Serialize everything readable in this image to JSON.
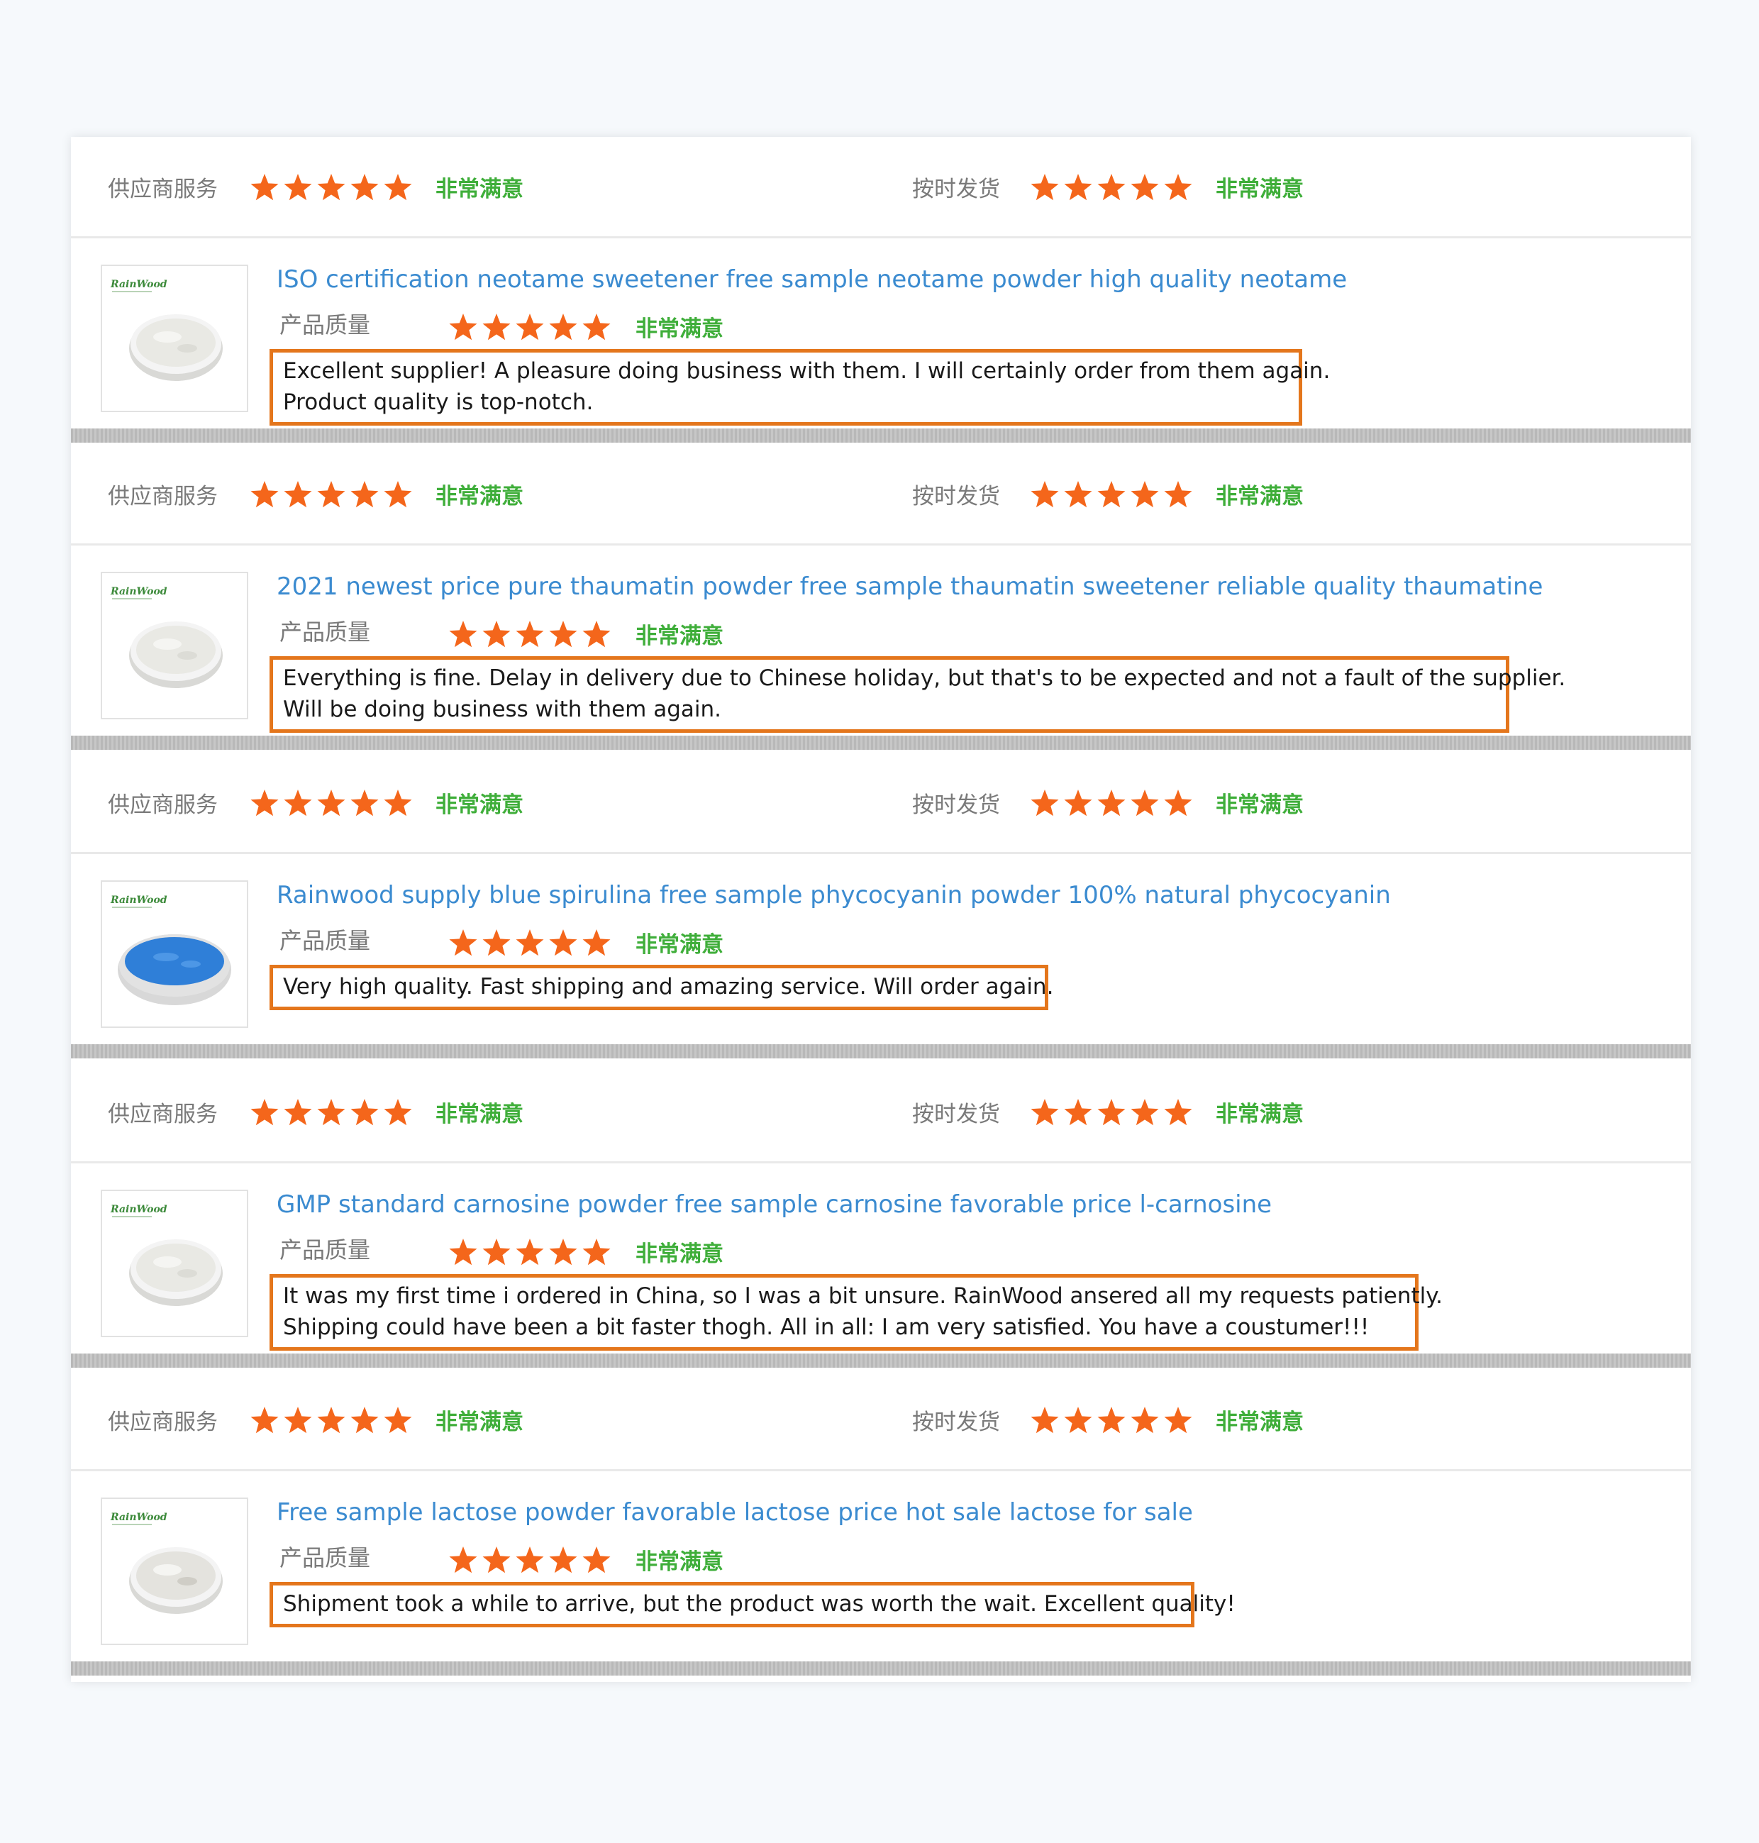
{
  "labels": {
    "supplier_service": "供应商服务",
    "on_time_delivery": "按时发货",
    "product_quality": "产品质量",
    "rating_text": "非常满意"
  },
  "colors": {
    "star": "#f4661b",
    "rating_text": "#3fae3a",
    "title_link": "#3b8bd0",
    "highlight_border": "#e4761c"
  },
  "reviews": [
    {
      "title": "ISO certification neotame sweetener free sample neotame powder high quality neotame",
      "supplier_service_stars": 5,
      "on_time_delivery_stars": 5,
      "product_quality_stars": 5,
      "thumbnail": {
        "brand": "RainWood",
        "powder": "white"
      },
      "comment_lines": [
        "Excellent supplier! A pleasure doing business with them. I will certainly order from them again.",
        "Product quality is top-notch."
      ]
    },
    {
      "title": "2021 newest price pure thaumatin powder free sample thaumatin sweetener reliable quality thaumatine",
      "supplier_service_stars": 5,
      "on_time_delivery_stars": 5,
      "product_quality_stars": 5,
      "thumbnail": {
        "brand": "RainWood",
        "powder": "white"
      },
      "comment_lines": [
        "Everything  is fine. Delay in delivery due to Chinese holiday, but that's to be expected and not a fault of the supplier.",
        "Will be doing business with them again."
      ]
    },
    {
      "title": "Rainwood supply blue spirulina free sample phycocyanin powder 100% natural phycocyanin",
      "supplier_service_stars": 5,
      "on_time_delivery_stars": 5,
      "product_quality_stars": 5,
      "thumbnail": {
        "brand": "RainWood",
        "powder": "blue"
      },
      "comment_lines": [
        "Very high quality. Fast shipping and amazing service. Will order again."
      ]
    },
    {
      "title": "GMP standard carnosine powder free sample carnosine favorable price l-carnosine",
      "supplier_service_stars": 5,
      "on_time_delivery_stars": 5,
      "product_quality_stars": 5,
      "thumbnail": {
        "brand": "RainWood",
        "powder": "white"
      },
      "comment_lines": [
        "It was my first time i ordered in China, so I was a bit unsure.  RainWood ansered all my requests patiently.",
        "Shipping could have been a bit faster thogh. All in all: I am very satisfied. You have a coustumer!!!"
      ]
    },
    {
      "title": "Free sample lactose powder favorable lactose price hot sale lactose for sale",
      "supplier_service_stars": 5,
      "on_time_delivery_stars": 5,
      "product_quality_stars": 5,
      "thumbnail": {
        "brand": "RainWood",
        "powder": "white-coarse"
      },
      "comment_lines": [
        "Shipment took a while to arrive, but the product was worth the wait. Excellent quality!"
      ]
    }
  ]
}
